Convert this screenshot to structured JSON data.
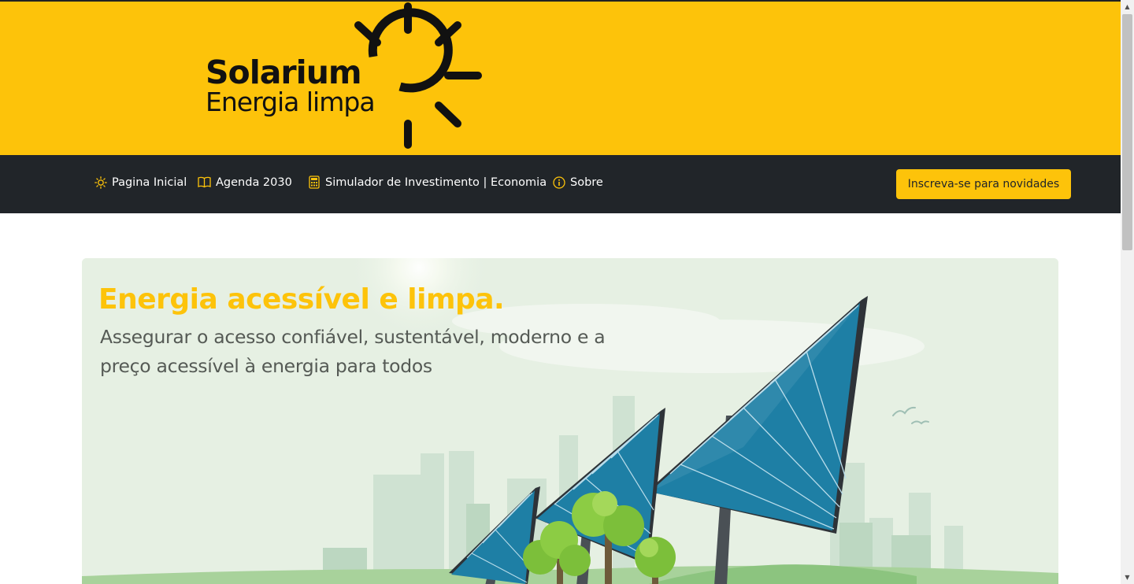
{
  "logo": {
    "line1": "Solarium",
    "line2": "Energia limpa"
  },
  "nav": {
    "items": [
      {
        "label": "Pagina Inicial",
        "icon": "sun-icon"
      },
      {
        "label": "Agenda 2030",
        "icon": "book-icon"
      },
      {
        "label": "Simulador de Investimento | Economia",
        "icon": "calculator-icon"
      },
      {
        "label": "Sobre",
        "icon": "info-icon"
      }
    ],
    "subscribe_label": "Inscreva-se para novidades"
  },
  "hero": {
    "title": "Energia acessível e limpa.",
    "subtitle": "Assegurar o acesso confiável, sustentável, moderno e a preço acessível à energia para todos"
  },
  "colors": {
    "brand": "#fdc30a",
    "navbar": "#212529",
    "hero_bg": "#e7f1e4"
  }
}
